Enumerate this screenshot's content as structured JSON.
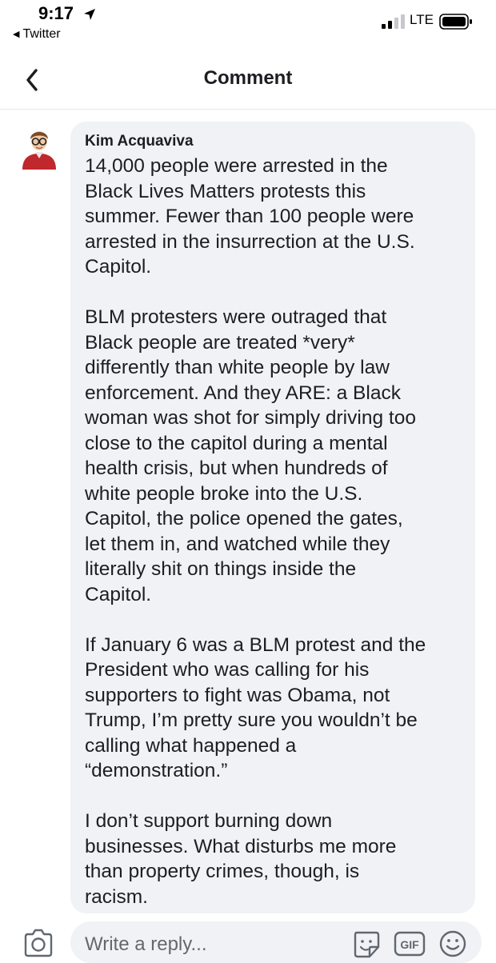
{
  "status_bar": {
    "time": "9:17",
    "back_app": "Twitter",
    "network": "LTE"
  },
  "header": {
    "title": "Comment"
  },
  "comment": {
    "author": "Kim Acquaviva",
    "paragraphs": [
      "14,000 people were arrested in the\nBlack Lives Matters protests this\nsummer. Fewer than 100 people were\narrested  in the insurrection at the U.S.\nCapitol.",
      "BLM protesters were outraged that\nBlack people are treated *very*\ndifferently than white people by law\nenforcement.  And they ARE: a Black\nwoman was shot for simply driving too\nclose to the capitol during a mental\nhealth crisis, but when hundreds of\nwhite people broke into the U.S.\nCapitol, the police opened the gates,\nlet them in, and watched while they\nliterally shit on things inside the\nCapitol.",
      "If January 6 was a BLM protest and the\nPresident  who was calling for his\nsupporters to fight was Obama, not\nTrump, I’m pretty sure you wouldn’t be\ncalling what happened a\n“demonstration.”",
      "I don’t support burning down\nbusinesses. What disturbs me more\nthan property crimes, though, is\nracism."
    ]
  },
  "composer": {
    "placeholder": "Write a reply...",
    "gif_label": "GIF"
  },
  "icons": {
    "location": "location-arrow-icon",
    "signal": "cellular-signal-icon",
    "battery": "battery-icon",
    "back": "chevron-left-icon",
    "camera": "camera-icon",
    "sticker": "sticker-icon",
    "gif": "gif-icon",
    "emoji": "emoji-icon"
  },
  "colors": {
    "bubble": "#f0f2f5",
    "text": "#1c1e21",
    "placeholder": "#65676b",
    "icon": "#606770"
  }
}
